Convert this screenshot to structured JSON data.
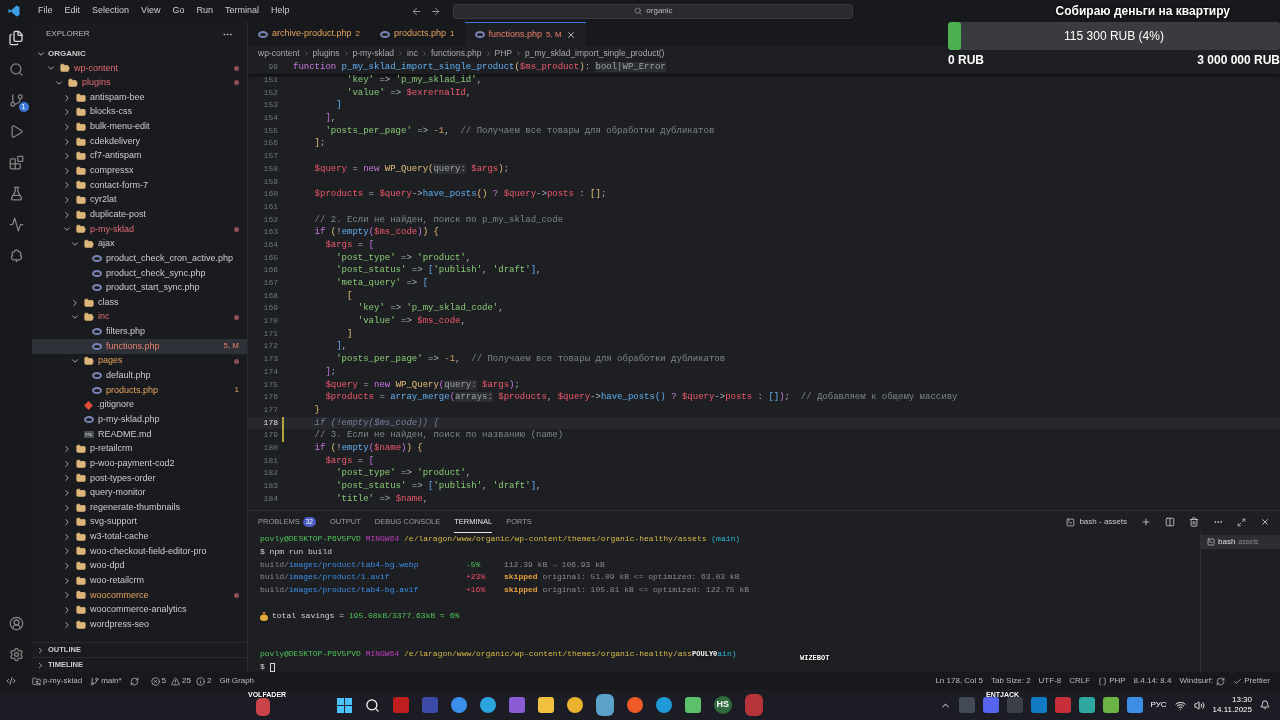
{
  "menu": [
    "File",
    "Edit",
    "Selection",
    "View",
    "Go",
    "Run",
    "Terminal",
    "Help"
  ],
  "search": {
    "value": "organic"
  },
  "donation": {
    "title": "Собираю деньги на квартиру",
    "amount": "115 300 RUB (4%)",
    "level": 0.04,
    "min": "0 RUB",
    "max": "3 000 000 RUB"
  },
  "activity_bar": {
    "source_control_badge": "1"
  },
  "explorer": {
    "title": "EXPLORER",
    "root": "ORGANIC",
    "root_expanded": true,
    "sections": [
      {
        "label": "OUTLINE",
        "expanded": false
      },
      {
        "label": "TIMELINE",
        "expanded": false
      }
    ],
    "tree": [
      {
        "name": "wp-content",
        "kind": "folder",
        "expanded": true,
        "selected": false,
        "modified": true,
        "problems": false,
        "dot": true,
        "children": [
          {
            "name": "plugins",
            "kind": "folder",
            "expanded": true,
            "selected": false,
            "modified": true,
            "problems": false,
            "dot": true,
            "children": [
              {
                "name": "antispam-bee",
                "kind": "folder",
                "expanded": false,
                "selected": false,
                "modified": false,
                "problems": false,
                "dot": false
              },
              {
                "name": "blocks-css",
                "kind": "folder",
                "expanded": false,
                "selected": false,
                "modified": false,
                "problems": false,
                "dot": false
              },
              {
                "name": "bulk-menu-edit",
                "kind": "folder",
                "expanded": false,
                "selected": false,
                "modified": false,
                "problems": false,
                "dot": false
              },
              {
                "name": "cdekdelivery",
                "kind": "folder",
                "expanded": false,
                "selected": false,
                "modified": false,
                "problems": false,
                "dot": false
              },
              {
                "name": "cf7-antispam",
                "kind": "folder",
                "expanded": false,
                "selected": false,
                "modified": false,
                "problems": false,
                "dot": false
              },
              {
                "name": "compressx",
                "kind": "folder",
                "expanded": false,
                "selected": false,
                "modified": false,
                "problems": false,
                "dot": false
              },
              {
                "name": "contact-form-7",
                "kind": "folder",
                "expanded": false,
                "selected": false,
                "modified": false,
                "problems": false,
                "dot": false
              },
              {
                "name": "cyr2lat",
                "kind": "folder",
                "expanded": false,
                "selected": false,
                "modified": false,
                "problems": false,
                "dot": false
              },
              {
                "name": "duplicate-post",
                "kind": "folder",
                "expanded": false,
                "selected": false,
                "modified": false,
                "problems": false,
                "dot": false
              },
              {
                "name": "p-my-sklad",
                "kind": "folder",
                "expanded": true,
                "selected": false,
                "modified": true,
                "problems": false,
                "dot": true,
                "children": [
                  {
                    "name": "ajax",
                    "kind": "folder",
                    "expanded": true,
                    "selected": false,
                    "modified": false,
                    "problems": false,
                    "dot": false,
                    "children": [
                      {
                        "name": "product_check_cron_active.php",
                        "kind": "php",
                        "selected": false,
                        "modified": false,
                        "problems": false,
                        "dot": false
                      },
                      {
                        "name": "product_check_sync.php",
                        "kind": "php",
                        "selected": false,
                        "modified": false,
                        "problems": false,
                        "dot": false
                      },
                      {
                        "name": "product_start_sync.php",
                        "kind": "php",
                        "selected": false,
                        "modified": false,
                        "problems": false,
                        "dot": false
                      }
                    ]
                  },
                  {
                    "name": "class",
                    "kind": "folder",
                    "expanded": false,
                    "selected": false,
                    "modified": false,
                    "problems": false,
                    "dot": false
                  },
                  {
                    "name": "inc",
                    "kind": "folder",
                    "expanded": true,
                    "selected": false,
                    "modified": true,
                    "problems": false,
                    "dot": true,
                    "children": [
                      {
                        "name": "filters.php",
                        "kind": "php",
                        "selected": false,
                        "modified": false,
                        "problems": false,
                        "dot": false
                      },
                      {
                        "name": "functions.php",
                        "kind": "php",
                        "selected": true,
                        "modified": true,
                        "problems": true,
                        "dot": false,
                        "badge": "5, M"
                      }
                    ]
                  },
                  {
                    "name": "pages",
                    "kind": "folder",
                    "expanded": true,
                    "selected": false,
                    "modified": false,
                    "problems": true,
                    "dot": true,
                    "children": [
                      {
                        "name": "default.php",
                        "kind": "php",
                        "selected": false,
                        "modified": false,
                        "problems": false,
                        "dot": false
                      },
                      {
                        "name": "products.php",
                        "kind": "php",
                        "selected": false,
                        "modified": false,
                        "problems": true,
                        "dot": false,
                        "badge": "1"
                      }
                    ]
                  },
                  {
                    "name": ".gitignore",
                    "kind": "git",
                    "selected": false,
                    "modified": false,
                    "problems": false,
                    "dot": false
                  },
                  {
                    "name": "p-my-sklad.php",
                    "kind": "php",
                    "selected": false,
                    "modified": false,
                    "problems": false,
                    "dot": false
                  },
                  {
                    "name": "README.md",
                    "kind": "md",
                    "selected": false,
                    "modified": false,
                    "problems": false,
                    "dot": false
                  }
                ]
              },
              {
                "name": "p-retailcrm",
                "kind": "folder",
                "expanded": false,
                "selected": false,
                "modified": false,
                "problems": false,
                "dot": false
              },
              {
                "name": "p-woo-payment-cod2",
                "kind": "folder",
                "expanded": false,
                "selected": false,
                "modified": false,
                "problems": false,
                "dot": false
              },
              {
                "name": "post-types-order",
                "kind": "folder",
                "expanded": false,
                "selected": false,
                "modified": false,
                "problems": false,
                "dot": false
              },
              {
                "name": "query-monitor",
                "kind": "folder",
                "expanded": false,
                "selected": false,
                "modified": false,
                "problems": false,
                "dot": false
              },
              {
                "name": "regenerate-thumbnails",
                "kind": "folder",
                "expanded": false,
                "selected": false,
                "modified": false,
                "problems": false,
                "dot": false
              },
              {
                "name": "svg-support",
                "kind": "folder",
                "expanded": false,
                "selected": false,
                "modified": false,
                "problems": false,
                "dot": false
              },
              {
                "name": "w3-total-cache",
                "kind": "folder",
                "expanded": false,
                "selected": false,
                "modified": false,
                "problems": false,
                "dot": false
              },
              {
                "name": "woo-checkout-field-editor-pro",
                "kind": "folder",
                "expanded": false,
                "selected": false,
                "modified": false,
                "problems": false,
                "dot": false
              },
              {
                "name": "woo-dpd",
                "kind": "folder",
                "expanded": false,
                "selected": false,
                "modified": false,
                "problems": false,
                "dot": false
              },
              {
                "name": "woo-retailcrm",
                "kind": "folder",
                "expanded": false,
                "selected": false,
                "modified": false,
                "problems": false,
                "dot": false
              },
              {
                "name": "woocommerce",
                "kind": "folder",
                "expanded": false,
                "selected": false,
                "modified": false,
                "problems": true,
                "dot": true
              },
              {
                "name": "woocommerce-analytics",
                "kind": "folder",
                "expanded": false,
                "selected": false,
                "modified": false,
                "problems": false,
                "dot": false
              },
              {
                "name": "wordpress-seo",
                "kind": "folder",
                "expanded": false,
                "selected": false,
                "modified": false,
                "problems": false,
                "dot": false
              }
            ]
          }
        ]
      }
    ]
  },
  "tabs": [
    {
      "label": "archive-product.php",
      "badge": "2",
      "modified": false,
      "problems": true,
      "selected": false
    },
    {
      "label": "products.php",
      "badge": "1",
      "modified": false,
      "problems": true,
      "selected": false
    },
    {
      "label": "functions.php",
      "badge": "5, M",
      "modified": true,
      "problems": true,
      "selected": true
    }
  ],
  "breadcrumbs": [
    "wp-content",
    "plugins",
    "p-my-sklad",
    "inc",
    "functions.php",
    "PHP",
    "p_my_sklad_import_single_product()"
  ],
  "editor": {
    "sticky": {
      "num": "99",
      "tokens": [
        {
          "kind": "k",
          "text": "function "
        },
        {
          "kind": "f",
          "text": "p_my_sklad_import_single_product"
        },
        {
          "kind": "b",
          "text": "("
        },
        {
          "kind": "v",
          "text": "$ms_product"
        },
        {
          "kind": "b",
          "text": ")"
        },
        {
          "kind": "p",
          "text": ": "
        },
        {
          "kind": "h",
          "text": "bool|WP_Error"
        }
      ]
    },
    "lines": [
      {
        "num": "151",
        "current": false,
        "modified": false,
        "tokens": [
          {
            "kind": "s",
            "text": "          'key'"
          },
          {
            "kind": "p",
            "text": " => "
          },
          {
            "kind": "s",
            "text": "'p_my_sklad_id'"
          },
          {
            "kind": "p",
            "text": ","
          }
        ]
      },
      {
        "num": "152",
        "current": false,
        "modified": false,
        "tokens": [
          {
            "kind": "s",
            "text": "          'value'"
          },
          {
            "kind": "p",
            "text": " => "
          },
          {
            "kind": "v",
            "text": "$exrernalId"
          },
          {
            "kind": "p",
            "text": ","
          }
        ]
      },
      {
        "num": "153",
        "current": false,
        "modified": false,
        "tokens": [
          {
            "kind": "b3",
            "text": "        ]"
          }
        ]
      },
      {
        "num": "154",
        "current": false,
        "modified": false,
        "tokens": [
          {
            "kind": "b2",
            "text": "      ]"
          },
          {
            "kind": "p",
            "text": ","
          }
        ]
      },
      {
        "num": "155",
        "current": false,
        "modified": false,
        "tokens": [
          {
            "kind": "s",
            "text": "      'posts_per_page'"
          },
          {
            "kind": "p",
            "text": " => "
          },
          {
            "kind": "n",
            "text": "-1"
          },
          {
            "kind": "p",
            "text": ","
          },
          {
            "kind": "m",
            "text": "  // Получаем все товары для обработки дубликатов"
          }
        ]
      },
      {
        "num": "156",
        "current": false,
        "modified": false,
        "tokens": [
          {
            "kind": "b",
            "text": "    ]"
          },
          {
            "kind": "p",
            "text": ";"
          }
        ]
      },
      {
        "num": "157",
        "current": false,
        "modified": false
      },
      {
        "num": "158",
        "current": false,
        "modified": false,
        "tokens": [
          {
            "kind": "v",
            "text": "    $query"
          },
          {
            "kind": "p",
            "text": " = "
          },
          {
            "kind": "k",
            "text": "new "
          },
          {
            "kind": "c",
            "text": "WP_Query"
          },
          {
            "kind": "b",
            "text": "("
          },
          {
            "kind": "h",
            "text": "query:"
          },
          {
            "kind": "v",
            "text": " $args"
          },
          {
            "kind": "b",
            "text": ")"
          },
          {
            "kind": "p",
            "text": ";"
          }
        ]
      },
      {
        "num": "159",
        "current": false,
        "modified": false
      },
      {
        "num": "160",
        "current": false,
        "modified": false,
        "tokens": [
          {
            "kind": "v",
            "text": "    $products"
          },
          {
            "kind": "p",
            "text": " = "
          },
          {
            "kind": "v",
            "text": "$query"
          },
          {
            "kind": "p",
            "text": "->"
          },
          {
            "kind": "f",
            "text": "have_posts"
          },
          {
            "kind": "b",
            "text": "()"
          },
          {
            "kind": "k",
            "text": " ? "
          },
          {
            "kind": "v",
            "text": "$query"
          },
          {
            "kind": "p",
            "text": "->"
          },
          {
            "kind": "v",
            "text": "posts"
          },
          {
            "kind": "p",
            "text": " : "
          },
          {
            "kind": "b",
            "text": "[]"
          },
          {
            "kind": "p",
            "text": ";"
          }
        ]
      },
      {
        "num": "161",
        "current": false,
        "modified": false
      },
      {
        "num": "162",
        "current": false,
        "modified": false,
        "tokens": [
          {
            "kind": "m",
            "text": "    // 2. Если не найден, поиск по p_my_sklad_code"
          }
        ]
      },
      {
        "num": "163",
        "current": false,
        "modified": false,
        "tokens": [
          {
            "kind": "k",
            "text": "    if "
          },
          {
            "kind": "b",
            "text": "("
          },
          {
            "kind": "p",
            "text": "!"
          },
          {
            "kind": "f",
            "text": "empty"
          },
          {
            "kind": "b2",
            "text": "("
          },
          {
            "kind": "v",
            "text": "$ms_code"
          },
          {
            "kind": "b2",
            "text": ")"
          },
          {
            "kind": "b",
            "text": ")"
          },
          {
            "kind": "b",
            "text": " {"
          }
        ]
      },
      {
        "num": "164",
        "current": false,
        "modified": false,
        "tokens": [
          {
            "kind": "v",
            "text": "      $args"
          },
          {
            "kind": "p",
            "text": " = "
          },
          {
            "kind": "b2",
            "text": "["
          }
        ]
      },
      {
        "num": "165",
        "current": false,
        "modified": false,
        "tokens": [
          {
            "kind": "s",
            "text": "        'post_type'"
          },
          {
            "kind": "p",
            "text": " => "
          },
          {
            "kind": "s",
            "text": "'product'"
          },
          {
            "kind": "p",
            "text": ","
          }
        ]
      },
      {
        "num": "166",
        "current": false,
        "modified": false,
        "tokens": [
          {
            "kind": "s",
            "text": "        'post_status'"
          },
          {
            "kind": "p",
            "text": " => "
          },
          {
            "kind": "b3",
            "text": "["
          },
          {
            "kind": "s",
            "text": "'publish'"
          },
          {
            "kind": "p",
            "text": ", "
          },
          {
            "kind": "s",
            "text": "'draft'"
          },
          {
            "kind": "b3",
            "text": "]"
          },
          {
            "kind": "p",
            "text": ","
          }
        ]
      },
      {
        "num": "167",
        "current": false,
        "modified": false,
        "tokens": [
          {
            "kind": "s",
            "text": "        'meta_query'"
          },
          {
            "kind": "p",
            "text": " => "
          },
          {
            "kind": "b3",
            "text": "["
          }
        ]
      },
      {
        "num": "168",
        "current": false,
        "modified": false,
        "tokens": [
          {
            "kind": "b",
            "text": "          ["
          }
        ]
      },
      {
        "num": "169",
        "current": false,
        "modified": false,
        "tokens": [
          {
            "kind": "s",
            "text": "            'key'"
          },
          {
            "kind": "p",
            "text": " => "
          },
          {
            "kind": "s",
            "text": "'p_my_sklad_code'"
          },
          {
            "kind": "p",
            "text": ","
          }
        ]
      },
      {
        "num": "170",
        "current": false,
        "modified": false,
        "tokens": [
          {
            "kind": "s",
            "text": "            'value'"
          },
          {
            "kind": "p",
            "text": " => "
          },
          {
            "kind": "v",
            "text": "$ms_code"
          },
          {
            "kind": "p",
            "text": ","
          }
        ]
      },
      {
        "num": "171",
        "current": false,
        "modified": false,
        "tokens": [
          {
            "kind": "b",
            "text": "          ]"
          }
        ]
      },
      {
        "num": "172",
        "current": false,
        "modified": false,
        "tokens": [
          {
            "kind": "b3",
            "text": "        ]"
          },
          {
            "kind": "p",
            "text": ","
          }
        ]
      },
      {
        "num": "173",
        "current": false,
        "modified": false,
        "tokens": [
          {
            "kind": "s",
            "text": "        'posts_per_page'"
          },
          {
            "kind": "p",
            "text": " => "
          },
          {
            "kind": "n",
            "text": "-1"
          },
          {
            "kind": "p",
            "text": ","
          },
          {
            "kind": "m",
            "text": "  // Получаем все товары для обработки дубликатов"
          }
        ]
      },
      {
        "num": "174",
        "current": false,
        "modified": false,
        "tokens": [
          {
            "kind": "b2",
            "text": "      ]"
          },
          {
            "kind": "p",
            "text": ";"
          }
        ]
      },
      {
        "num": "175",
        "current": false,
        "modified": false,
        "tokens": [
          {
            "kind": "v",
            "text": "      $query"
          },
          {
            "kind": "p",
            "text": " = "
          },
          {
            "kind": "k",
            "text": "new "
          },
          {
            "kind": "c",
            "text": "WP_Query"
          },
          {
            "kind": "b2",
            "text": "("
          },
          {
            "kind": "h",
            "text": "query:"
          },
          {
            "kind": "v",
            "text": " $args"
          },
          {
            "kind": "b2",
            "text": ")"
          },
          {
            "kind": "p",
            "text": ";"
          }
        ]
      },
      {
        "num": "176",
        "current": false,
        "modified": false,
        "tokens": [
          {
            "kind": "v",
            "text": "      $products"
          },
          {
            "kind": "p",
            "text": " = "
          },
          {
            "kind": "f",
            "text": "array_merge"
          },
          {
            "kind": "b2",
            "text": "("
          },
          {
            "kind": "h",
            "text": "arrays:"
          },
          {
            "kind": "v",
            "text": " $products"
          },
          {
            "kind": "p",
            "text": ", "
          },
          {
            "kind": "v",
            "text": "$query"
          },
          {
            "kind": "p",
            "text": "->"
          },
          {
            "kind": "f",
            "text": "have_posts"
          },
          {
            "kind": "b3",
            "text": "()"
          },
          {
            "kind": "k",
            "text": " ? "
          },
          {
            "kind": "v",
            "text": "$query"
          },
          {
            "kind": "p",
            "text": "->"
          },
          {
            "kind": "v",
            "text": "posts"
          },
          {
            "kind": "p",
            "text": " : "
          },
          {
            "kind": "b3",
            "text": "[]"
          },
          {
            "kind": "b2",
            "text": ")"
          },
          {
            "kind": "p",
            "text": ";"
          },
          {
            "kind": "m",
            "text": "  // Добавляем к общему массиву"
          }
        ]
      },
      {
        "num": "177",
        "current": false,
        "modified": false,
        "tokens": [
          {
            "kind": "b",
            "text": "    }"
          }
        ]
      },
      {
        "num": "178",
        "current": true,
        "modified": true,
        "tokens": [
          {
            "kind": "g",
            "text": "    if (!empty($ms_code)) {"
          }
        ]
      },
      {
        "num": "179",
        "current": false,
        "modified": true,
        "tokens": [
          {
            "kind": "m",
            "text": "    // 3. Если не найден, поиск по названию (name)"
          }
        ]
      },
      {
        "num": "180",
        "current": false,
        "modified": false,
        "tokens": [
          {
            "kind": "k",
            "text": "    if "
          },
          {
            "kind": "b",
            "text": "("
          },
          {
            "kind": "p",
            "text": "!"
          },
          {
            "kind": "f",
            "text": "empty"
          },
          {
            "kind": "b2",
            "text": "("
          },
          {
            "kind": "v",
            "text": "$name"
          },
          {
            "kind": "b2",
            "text": ")"
          },
          {
            "kind": "b",
            "text": ")"
          },
          {
            "kind": "b",
            "text": " {"
          }
        ]
      },
      {
        "num": "181",
        "current": false,
        "modified": false,
        "tokens": [
          {
            "kind": "v",
            "text": "      $args"
          },
          {
            "kind": "p",
            "text": " = "
          },
          {
            "kind": "b2",
            "text": "["
          }
        ]
      },
      {
        "num": "182",
        "current": false,
        "modified": false,
        "tokens": [
          {
            "kind": "s",
            "text": "        'post_type'"
          },
          {
            "kind": "p",
            "text": " => "
          },
          {
            "kind": "s",
            "text": "'product'"
          },
          {
            "kind": "p",
            "text": ","
          }
        ]
      },
      {
        "num": "183",
        "current": false,
        "modified": false,
        "tokens": [
          {
            "kind": "s",
            "text": "        'post_status'"
          },
          {
            "kind": "p",
            "text": " => "
          },
          {
            "kind": "b3",
            "text": "["
          },
          {
            "kind": "s",
            "text": "'publish'"
          },
          {
            "kind": "p",
            "text": ", "
          },
          {
            "kind": "s",
            "text": "'draft'"
          },
          {
            "kind": "b3",
            "text": "]"
          },
          {
            "kind": "p",
            "text": ","
          }
        ]
      },
      {
        "num": "184",
        "current": false,
        "modified": false,
        "tokens": [
          {
            "kind": "s",
            "text": "        'title'"
          },
          {
            "kind": "p",
            "text": " => "
          },
          {
            "kind": "v",
            "text": "$name"
          },
          {
            "kind": "p",
            "text": ","
          }
        ]
      }
    ]
  },
  "panel": {
    "tabs": [
      {
        "label": "PROBLEMS",
        "badge": "32",
        "selected": false
      },
      {
        "label": "OUTPUT",
        "selected": false
      },
      {
        "label": "DEBUG CONSOLE",
        "selected": false
      },
      {
        "label": "TERMINAL",
        "selected": true
      },
      {
        "label": "PORTS",
        "selected": false
      }
    ],
    "terminal_title": "bash - assets",
    "terminals": [
      {
        "name": "bash",
        "folder": "assets",
        "selected": true
      }
    ],
    "lines": [
      {
        "kind": "text",
        "tokens": [
          {
            "kind": "tg",
            "text": "povly@DESKTOP-P6V5PVD "
          },
          {
            "kind": "tp",
            "text": "MINGW64 "
          },
          {
            "kind": "ty",
            "text": "/e/laragon/www/organic/wp-content/themes/organic-healthy/assets "
          },
          {
            "kind": "tc",
            "text": "(main)"
          }
        ]
      },
      {
        "kind": "text",
        "tokens": [
          {
            "kind": "tw",
            "text": "$ npm run build"
          }
        ]
      },
      {
        "kind": "optimize",
        "dir": "build/",
        "file": "images/product/tab4-bg.webp",
        "delta": "-5%",
        "increase": false,
        "detail": "112.39 kB → 106.93 kB"
      },
      {
        "kind": "optimize",
        "dir": "build/",
        "file": "images/product/1.avif",
        "delta": "+23%",
        "increase": true,
        "status": "skipped",
        "detail": "original: 51.09 kB <= optimized: 63.03 kB"
      },
      {
        "kind": "optimize",
        "dir": "build/",
        "file": "images/product/tab4-bg.avif",
        "delta": "+16%",
        "increase": true,
        "status": "skipped",
        "detail": "original: 105.81 kB <= optimized: 122.75 kB"
      },
      {
        "kind": "blank"
      },
      {
        "kind": "savings",
        "tokens": [
          {
            "kind": "tw",
            "text": "total savings = "
          },
          {
            "kind": "tgr",
            "text": "195.08kB/3377.63kB ≈ 6%"
          }
        ]
      },
      {
        "kind": "blank"
      },
      {
        "kind": "blank"
      },
      {
        "kind": "text",
        "tokens": [
          {
            "kind": "tg",
            "text": "povly@DESKTOP-P6V5PVD "
          },
          {
            "kind": "tp",
            "text": "MINGW64 "
          },
          {
            "kind": "ty",
            "text": "/e/laragon/www/organic/wp-content/themes/organic-healthy/ass"
          },
          {
            "kind": "tag",
            "text": "POULY0"
          },
          {
            "kind": "tc",
            "text": "ain)"
          }
        ]
      },
      {
        "kind": "input",
        "tokens": [
          {
            "kind": "tw",
            "text": "$"
          }
        ]
      }
    ]
  },
  "overlay_tags": [
    "WIZEBOT",
    "VOLFADER",
    "ENTJACK"
  ],
  "status_bar": {
    "repo": "p-my-sklad",
    "branch": "main*",
    "errors": "5",
    "warnings": "25",
    "infos": "2",
    "git_graph": "Git Graph",
    "position": "Ln 178, Col 5",
    "tab_size": "Tab Size: 2",
    "encoding": "UTF-8",
    "eol": "CRLF",
    "language": "PHP",
    "php_version": "8.4.14: 8.4",
    "windsurf": "Windsurf:",
    "prettier": "Prettier"
  },
  "taskbar": {
    "app_label": "HS",
    "language": "РУС",
    "time": "13:30",
    "date": "14.11.2025"
  }
}
